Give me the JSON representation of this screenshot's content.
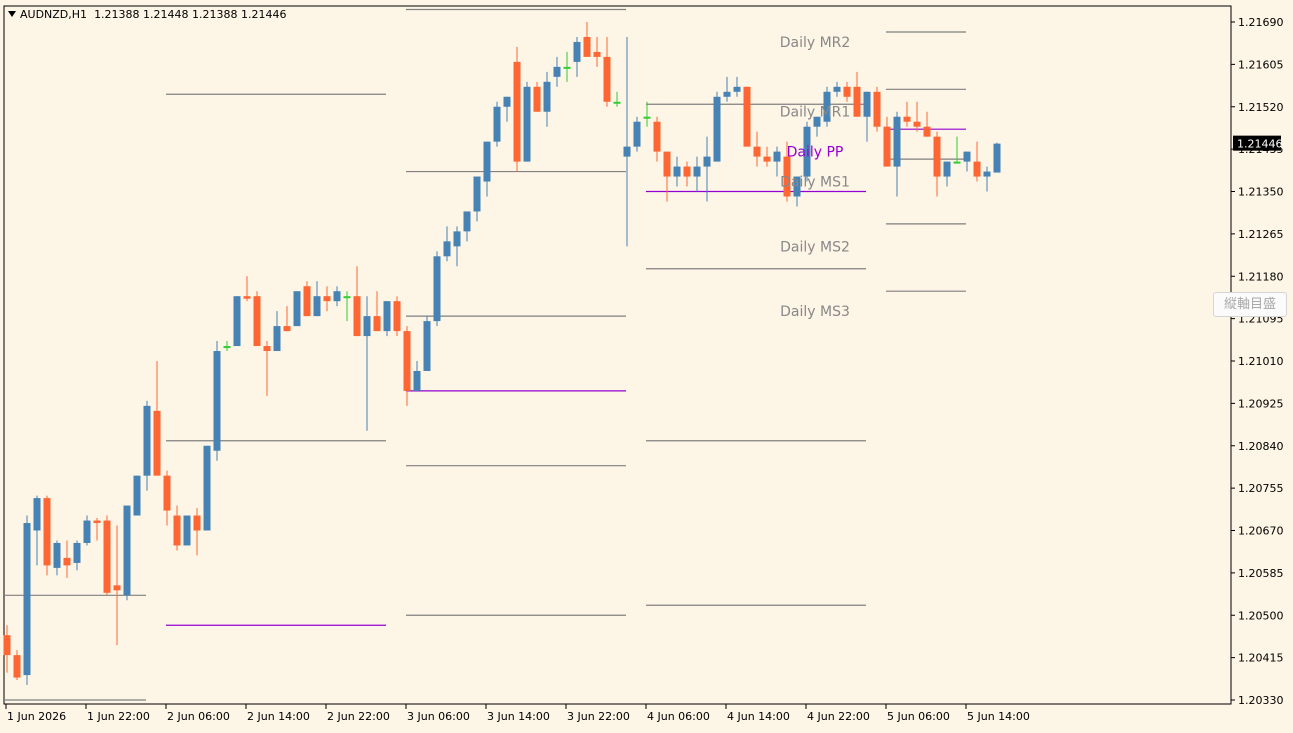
{
  "header": {
    "symbol": "AUDNZD,H1",
    "ohlc": "1.21388 1.21448 1.21388 1.21446"
  },
  "current_price": "1.21446",
  "vertical_scale_button": "縦軸目盛",
  "colors": {
    "background": "#fdf5e6",
    "up": "#4682b4",
    "down": "#ff6633",
    "level": "#808080",
    "pivot": "#9400d3",
    "doji": "#33cc33"
  },
  "chart_data": {
    "type": "candlestick",
    "symbol": "AUDNZD",
    "timeframe": "H1",
    "ylim": [
      1.2029,
      1.2175
    ],
    "y_ticks": [
      "1.21690",
      "1.21605",
      "1.21520",
      "1.21435",
      "1.21350",
      "1.21265",
      "1.21180",
      "1.21095",
      "1.21010",
      "1.20925",
      "1.20840",
      "1.20755",
      "1.20670",
      "1.20585",
      "1.20500",
      "1.20415",
      "1.20330"
    ],
    "x_ticks": [
      "1 Jun 2026",
      "1 Jun 22:00",
      "2 Jun 06:00",
      "2 Jun 14:00",
      "2 Jun 22:00",
      "3 Jun 06:00",
      "3 Jun 14:00",
      "3 Jun 22:00",
      "4 Jun 06:00",
      "4 Jun 14:00",
      "4 Jun 22:00",
      "5 Jun 06:00",
      "5 Jun 14:00"
    ],
    "candles": [
      [
        1.2046,
        1.2048,
        1.20385,
        1.2042
      ],
      [
        1.2042,
        1.2043,
        1.2037,
        1.20375
      ],
      [
        1.2038,
        1.207,
        1.2036,
        1.20685
      ],
      [
        1.2067,
        1.2074,
        1.206,
        1.20735
      ],
      [
        1.20735,
        1.2074,
        1.2058,
        1.206
      ],
      [
        1.20595,
        1.2065,
        1.2058,
        1.20645
      ],
      [
        1.20615,
        1.2065,
        1.20575,
        1.206
      ],
      [
        1.20605,
        1.2065,
        1.2059,
        1.20645
      ],
      [
        1.20645,
        1.207,
        1.2064,
        1.2069
      ],
      [
        1.2069,
        1.20695,
        1.2065,
        1.20685
      ],
      [
        1.2069,
        1.207,
        1.2054,
        1.20545
      ],
      [
        1.2056,
        1.2068,
        1.2044,
        1.2055
      ],
      [
        1.2054,
        1.2072,
        1.2053,
        1.2072
      ],
      [
        1.207,
        1.2078,
        1.207,
        1.2078
      ],
      [
        1.2078,
        1.2093,
        1.2075,
        1.2092
      ],
      [
        1.2091,
        1.2101,
        1.2082,
        1.2078
      ],
      [
        1.2078,
        1.2079,
        1.2068,
        1.2071
      ],
      [
        1.207,
        1.2072,
        1.2063,
        1.2064
      ],
      [
        1.2064,
        1.207,
        1.2064,
        1.207
      ],
      [
        1.207,
        1.20715,
        1.2062,
        1.2067
      ],
      [
        1.2067,
        1.2084,
        1.2067,
        1.2084
      ],
      [
        1.2083,
        1.2105,
        1.2081,
        1.2103
      ],
      [
        1.2104,
        1.2105,
        1.2103,
        1.2104
      ],
      [
        1.2104,
        1.2114,
        1.2104,
        1.2114
      ],
      [
        1.2114,
        1.2118,
        1.2113,
        1.21135
      ],
      [
        1.2114,
        1.2115,
        1.2104,
        1.2104
      ],
      [
        1.2104,
        1.2105,
        1.2094,
        1.2103
      ],
      [
        1.2103,
        1.2111,
        1.2103,
        1.2108
      ],
      [
        1.2108,
        1.2112,
        1.2107,
        1.2107
      ],
      [
        1.2108,
        1.2115,
        1.2108,
        1.2115
      ],
      [
        1.2116,
        1.2117,
        1.211,
        1.211
      ],
      [
        1.211,
        1.2117,
        1.211,
        1.2114
      ],
      [
        1.2114,
        1.2116,
        1.2111,
        1.2113
      ],
      [
        1.2113,
        1.2116,
        1.2112,
        1.2115
      ],
      [
        1.2114,
        1.2115,
        1.2109,
        1.2114
      ],
      [
        1.2114,
        1.212,
        1.2106,
        1.2106
      ],
      [
        1.2106,
        1.2114,
        1.2087,
        1.211
      ],
      [
        1.211,
        1.2115,
        1.2107,
        1.2107
      ],
      [
        1.2107,
        1.2113,
        1.2106,
        1.2113
      ],
      [
        1.2113,
        1.2114,
        1.2106,
        1.2107
      ],
      [
        1.2107,
        1.2108,
        1.2092,
        1.2095
      ],
      [
        1.2095,
        1.2101,
        1.2095,
        1.2099
      ],
      [
        1.2099,
        1.211,
        1.2099,
        1.2109
      ],
      [
        1.2109,
        1.2123,
        1.2108,
        1.2122
      ],
      [
        1.2122,
        1.2128,
        1.2121,
        1.2125
      ],
      [
        1.2124,
        1.2128,
        1.212,
        1.2127
      ],
      [
        1.2127,
        1.2131,
        1.2125,
        1.2131
      ],
      [
        1.2131,
        1.2138,
        1.2129,
        1.2138
      ],
      [
        1.2137,
        1.2145,
        1.2134,
        1.2145
      ],
      [
        1.2145,
        1.2153,
        1.2144,
        1.2152
      ],
      [
        1.2152,
        1.2154,
        1.2149,
        1.2154
      ],
      [
        1.2161,
        1.2164,
        1.2139,
        1.2141
      ],
      [
        1.2141,
        1.2157,
        1.2141,
        1.2156
      ],
      [
        1.2156,
        1.2157,
        1.2151,
        1.2151
      ],
      [
        1.2151,
        1.2159,
        1.2148,
        1.2157
      ],
      [
        1.2158,
        1.2162,
        1.2156,
        1.216
      ],
      [
        1.216,
        1.2163,
        1.2157,
        1.216
      ],
      [
        1.2161,
        1.2166,
        1.2158,
        1.2165
      ],
      [
        1.2166,
        1.2169,
        1.2163,
        1.2162
      ],
      [
        1.2163,
        1.2166,
        1.216,
        1.2162
      ],
      [
        1.2162,
        1.2166,
        1.2152,
        1.2153
      ],
      [
        1.2153,
        1.2155,
        1.2152,
        1.2153
      ],
      [
        1.2142,
        1.2166,
        1.2124,
        1.2144
      ],
      [
        1.2144,
        1.215,
        1.2143,
        1.2149
      ],
      [
        1.215,
        1.2153,
        1.2148,
        1.215
      ],
      [
        1.2149,
        1.215,
        1.2141,
        1.2143
      ],
      [
        1.2143,
        1.2143,
        1.2133,
        1.2138
      ],
      [
        1.2138,
        1.2142,
        1.2136,
        1.214
      ],
      [
        1.214,
        1.2141,
        1.2136,
        1.2138
      ],
      [
        1.2138,
        1.2142,
        1.2135,
        1.214
      ],
      [
        1.214,
        1.2146,
        1.2133,
        1.2142
      ],
      [
        1.2141,
        1.2155,
        1.2141,
        1.2154
      ],
      [
        1.2154,
        1.2158,
        1.2153,
        1.2155
      ],
      [
        1.2155,
        1.2158,
        1.2154,
        1.2156
      ],
      [
        1.2156,
        1.2156,
        1.2144,
        1.2144
      ],
      [
        1.2144,
        1.2147,
        1.214,
        1.2142
      ],
      [
        1.2142,
        1.2144,
        1.214,
        1.2141
      ],
      [
        1.2141,
        1.2144,
        1.2138,
        1.2143
      ],
      [
        1.2142,
        1.2145,
        1.2133,
        1.2134
      ],
      [
        1.2134,
        1.2138,
        1.2132,
        1.2138
      ],
      [
        1.2138,
        1.2149,
        1.2137,
        1.2148
      ],
      [
        1.2148,
        1.215,
        1.2146,
        1.215
      ],
      [
        1.2149,
        1.2156,
        1.2148,
        1.2155
      ],
      [
        1.2155,
        1.2157,
        1.2154,
        1.2156
      ],
      [
        1.2156,
        1.2157,
        1.2153,
        1.2154
      ],
      [
        1.2156,
        1.2159,
        1.215,
        1.215
      ],
      [
        1.215,
        1.2155,
        1.2145,
        1.2155
      ],
      [
        1.2155,
        1.2156,
        1.2147,
        1.2148
      ],
      [
        1.2148,
        1.215,
        1.214,
        1.214
      ],
      [
        1.214,
        1.2151,
        1.2134,
        1.215
      ],
      [
        1.215,
        1.2153,
        1.2148,
        1.2149
      ],
      [
        1.2149,
        1.2153,
        1.2147,
        1.2148
      ],
      [
        1.2148,
        1.2151,
        1.2146,
        1.2146
      ],
      [
        1.2146,
        1.2147,
        1.2134,
        1.2138
      ],
      [
        1.2138,
        1.2141,
        1.2136,
        1.2141
      ],
      [
        1.2141,
        1.2146,
        1.2141,
        1.2141
      ],
      [
        1.2141,
        1.2143,
        1.2139,
        1.2143
      ],
      [
        1.2141,
        1.2145,
        1.2137,
        1.2138
      ],
      [
        1.2138,
        1.214,
        1.2135,
        1.2139
      ],
      [
        1.21388,
        1.21448,
        1.21388,
        1.21446
      ]
    ],
    "pivot_levels": [
      {
        "day": "1 Jun",
        "MR1": 1.2054,
        "MS1": 1.2033
      },
      {
        "day": "2 Jun",
        "MR1": 1.21545,
        "PP": 1.2048,
        "MS1": 1.2085
      },
      {
        "day": "3 Jun",
        "MR2": 1.21715,
        "MR1": 1.2139,
        "MS1": 1.211,
        "PP": 1.2095,
        "MS2": 1.208,
        "MS3": 1.205
      },
      {
        "day": "4 Jun",
        "MR1": 1.21525,
        "PP": 1.2135,
        "MS1": 1.21195,
        "MS2": 1.2085,
        "MS3": 1.2052
      },
      {
        "day": "5 Jun",
        "MR2": 1.2167,
        "MR1": 1.21555,
        "PP": 1.21475,
        "MS1": 1.21415,
        "MS2": 1.21285,
        "MS3": 1.2115
      }
    ],
    "level_labels": [
      "Daily MR2",
      "Daily MR1",
      "Daily PP",
      "Daily MS1",
      "Daily MS2",
      "Daily MS3"
    ]
  }
}
